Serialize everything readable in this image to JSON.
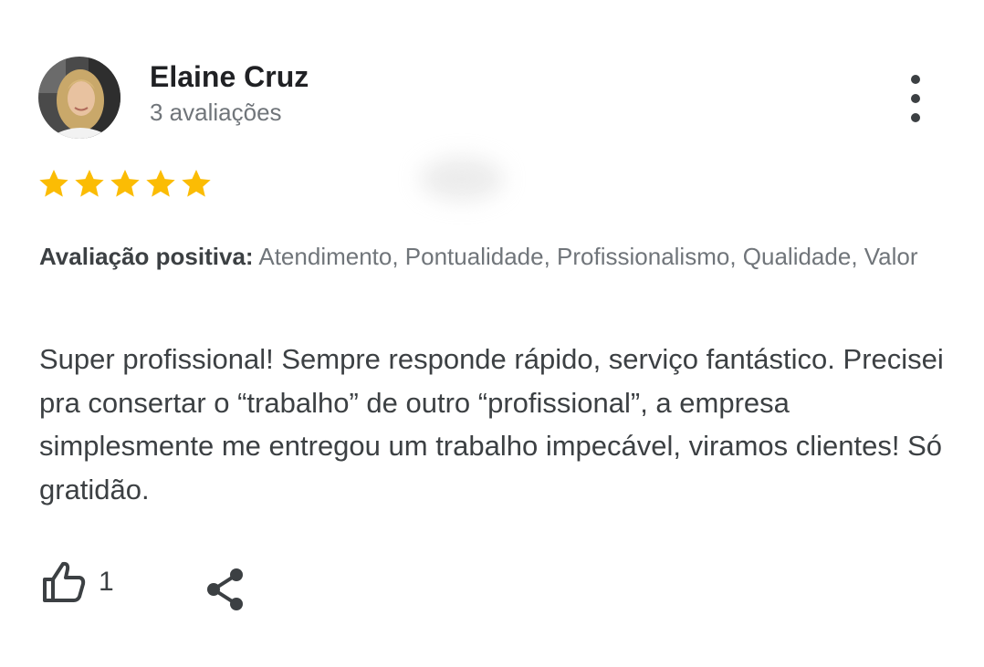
{
  "reviewer": {
    "name": "Elaine Cruz",
    "review_count": "3 avaliações"
  },
  "rating": {
    "stars": 5,
    "max": 5,
    "star_color": "#fbbc04"
  },
  "positive_review": {
    "label": "Avaliação positiva:",
    "attributes": " Atendimento, Pontualidade, Profissionalismo, Qualidade, Valor"
  },
  "review_text": "Super profissional! Sempre responde rápido, serviço fantástico. Precisei pra consertar o “trabalho” de outro “profissional”, a empresa simplesmente me entregou um trabalho impecável, viramos clientes! Só gratidão.",
  "actions": {
    "like_count": "1",
    "like_icon": "thumbs-up-icon",
    "share_icon": "share-icon",
    "more_icon": "more-vert-icon"
  },
  "colors": {
    "text_primary": "#202124",
    "text_secondary": "#70757a",
    "text_body": "#3c4043"
  }
}
